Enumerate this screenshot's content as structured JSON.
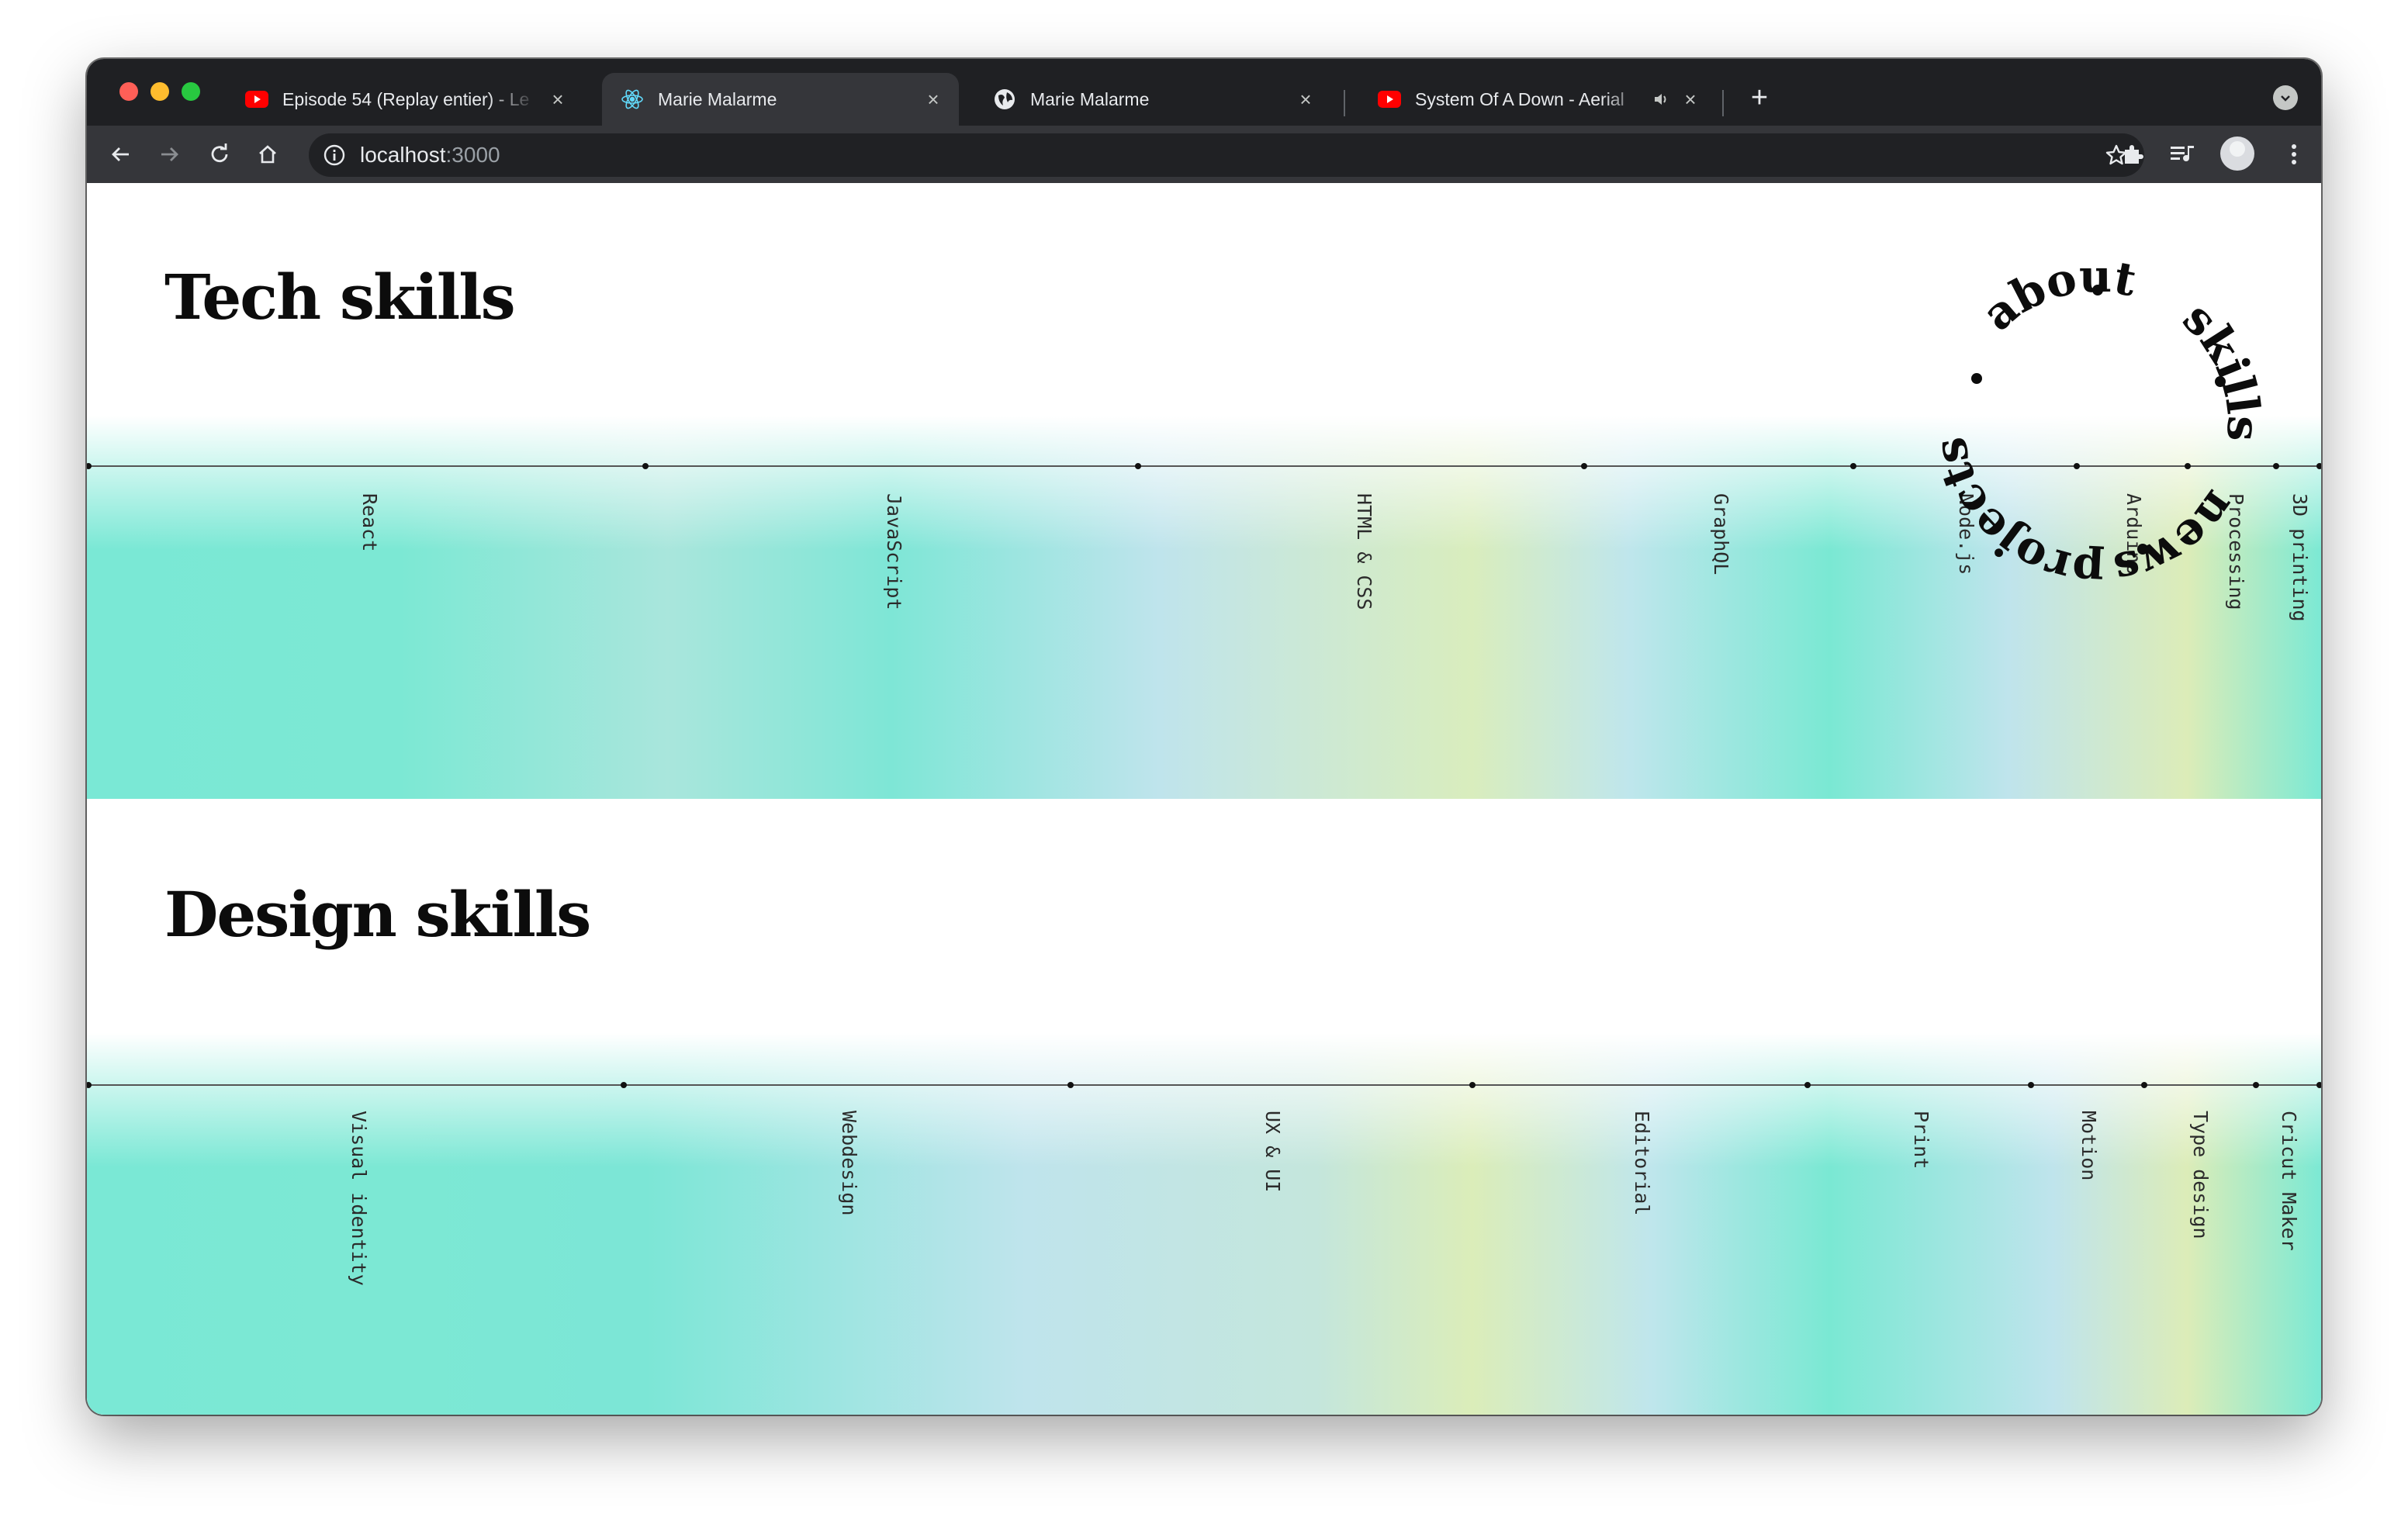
{
  "browser": {
    "tabs": [
      {
        "title": "Episode 54 (Replay entier) - Le",
        "favicon": "youtube-icon",
        "active": false
      },
      {
        "title": "Marie Malarme",
        "favicon": "react-icon",
        "active": true
      },
      {
        "title": "Marie Malarme",
        "favicon": "globe-icon",
        "active": false
      },
      {
        "title": "System Of A Down - Aerial",
        "favicon": "youtube-icon",
        "active": false,
        "audio": true
      }
    ],
    "url_host": "localhost",
    "url_port": ":3000"
  },
  "sections": [
    {
      "heading": "Tech skills",
      "skills": [
        "React",
        "JavaScript",
        "HTML & CSS",
        "GraphQL",
        "Node.js",
        "Arduino",
        "Processing",
        "3D printing"
      ]
    },
    {
      "heading": "Design skills",
      "skills": [
        "Visual identity",
        "Webdesign",
        "UX & UI",
        "Editorial",
        "Print",
        "Motion",
        "Type design",
        "Cricut Maker"
      ]
    }
  ],
  "nav_ring": [
    "about",
    "skills",
    "news",
    "projects"
  ],
  "colors": {
    "mint": "#74e8d3",
    "light_blue": "#bfe6ec",
    "pale_yellow": "#dcecb8",
    "ink": "#0c0c0c"
  }
}
